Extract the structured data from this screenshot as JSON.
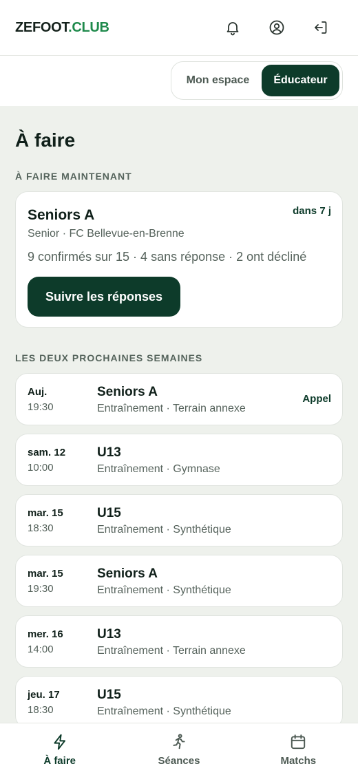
{
  "header": {
    "logo_main": "ZEFOOT",
    "logo_accent": ".CLUB",
    "icons": [
      "bell-icon",
      "user-circle-icon",
      "logout-icon"
    ]
  },
  "switcher": {
    "options": [
      "Mon espace",
      "Éducateur"
    ],
    "selected": "Éducateur"
  },
  "page": {
    "title": "À faire",
    "now_label": "À FAIRE MAINTENANT",
    "upcoming_label": "LES DEUX PROCHAINES SEMAINES"
  },
  "hero": {
    "title": "Seniors A",
    "when": "dans 7 j",
    "subtitle": "Senior · FC Bellevue-en-Brenne",
    "stats": "9 confirmés sur 15 · 4 sans réponse · 2 ont décliné",
    "cta": "Suivre les réponses"
  },
  "sessions": [
    {
      "day": "Auj.",
      "time": "19:30",
      "team": "Seniors A",
      "detail": "Entraînement · Terrain annexe",
      "badge": "Appel"
    },
    {
      "day": "sam. 12",
      "time": "10:00",
      "team": "U13",
      "detail": "Entraînement · Gymnase",
      "badge": ""
    },
    {
      "day": "mar. 15",
      "time": "18:30",
      "team": "U15",
      "detail": "Entraînement · Synthétique",
      "badge": ""
    },
    {
      "day": "mar. 15",
      "time": "19:30",
      "team": "Seniors A",
      "detail": "Entraînement · Synthétique",
      "badge": ""
    },
    {
      "day": "mer. 16",
      "time": "14:00",
      "team": "U13",
      "detail": "Entraînement · Terrain annexe",
      "badge": ""
    },
    {
      "day": "jeu. 17",
      "time": "18:30",
      "team": "U15",
      "detail": "Entraînement · Synthétique",
      "badge": ""
    }
  ],
  "nav": [
    {
      "label": "À faire",
      "icon": "lightning-icon",
      "active": true
    },
    {
      "label": "Séances",
      "icon": "running-person-icon",
      "active": false
    },
    {
      "label": "Matchs",
      "icon": "calendar-icon",
      "active": false
    }
  ],
  "colors": {
    "primary": "#0d3b2a",
    "accent": "#1f8a4c",
    "background": "#eef1ec"
  }
}
